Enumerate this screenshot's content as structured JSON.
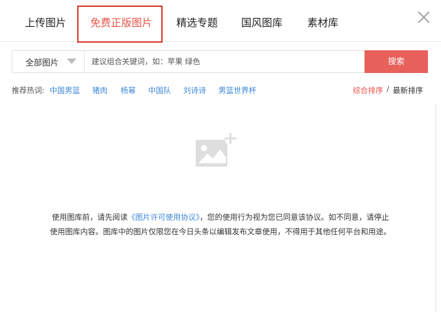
{
  "tabs": [
    {
      "label": "上传图片"
    },
    {
      "label": "免费正版图片"
    },
    {
      "label": "精选专题"
    },
    {
      "label": "国风图库"
    },
    {
      "label": "素材库"
    }
  ],
  "search": {
    "category": "全部图片",
    "placeholder": "建议组合关键词，如：苹果 绿色",
    "button_label": "搜索"
  },
  "hot": {
    "label": "推荐热词:",
    "items": [
      "中国男篮",
      "猪肉",
      "杨幂",
      "中国队",
      "刘诗诗",
      "男篮世界杯"
    ]
  },
  "sort": {
    "active": "综合排序",
    "separator": "/",
    "other": "最新排序"
  },
  "notice": {
    "part1": "使用图库前，请先阅读",
    "link": "《图片许可使用协议》",
    "part2": "，您的使用行为视为您已同意该协议。如不同意，请停止",
    "line2": "使用图库内容。图库中的图片仅限您在今日头条以编辑发布文章使用，不得用于其他任何平台和用途。"
  },
  "colors": {
    "accent": "#e8544b",
    "highlight_border": "#d63c2f",
    "link": "#3d87d9",
    "search_button": "#e8605a"
  },
  "icons": {
    "close": "close-icon",
    "dropdown": "caret-down-icon",
    "placeholder": "image-add-placeholder-icon"
  }
}
